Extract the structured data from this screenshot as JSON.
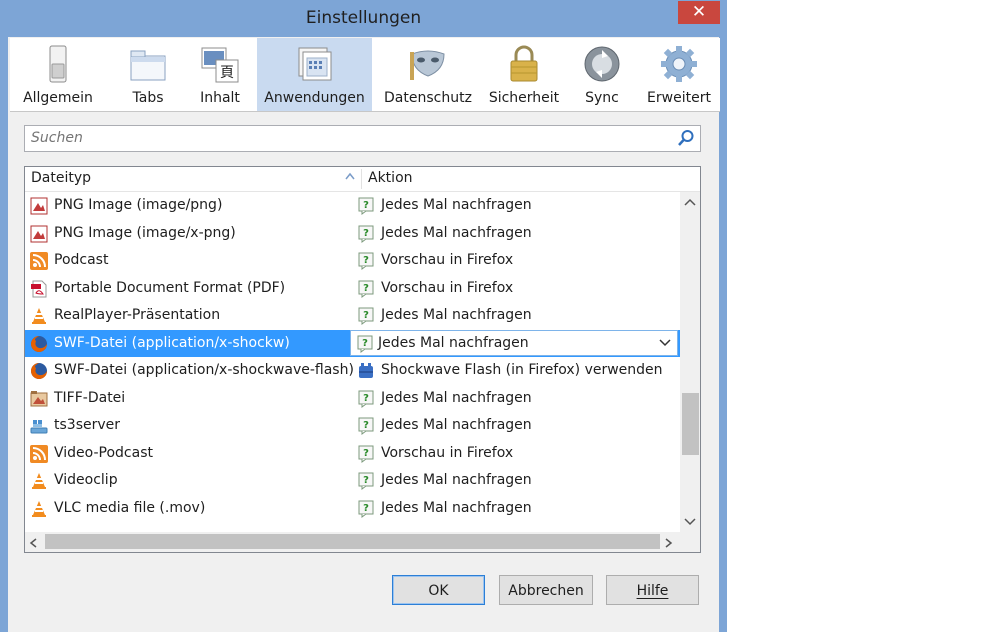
{
  "window": {
    "title": "Einstellungen",
    "close": "✕"
  },
  "toolbar": {
    "items": [
      {
        "label": "Allgemein",
        "icon": "switch-icon"
      },
      {
        "label": "Tabs",
        "icon": "tabs-icon"
      },
      {
        "label": "Inhalt",
        "icon": "content-icon"
      },
      {
        "label": "Anwendungen",
        "icon": "applications-icon",
        "selected": true
      },
      {
        "label": "Datenschutz",
        "icon": "mask-icon"
      },
      {
        "label": "Sicherheit",
        "icon": "lock-icon"
      },
      {
        "label": "Sync",
        "icon": "sync-icon"
      },
      {
        "label": "Erweitert",
        "icon": "gear-icon"
      }
    ]
  },
  "search": {
    "placeholder": "Suchen"
  },
  "table": {
    "columns": {
      "type": "Dateityp",
      "action": "Aktion"
    },
    "rows": [
      {
        "type": "PNG Image (image/png)",
        "type_icon": "image-icon",
        "action": "Jedes Mal nachfragen",
        "action_icon": "ask-icon"
      },
      {
        "type": "PNG Image (image/x-png)",
        "type_icon": "image-icon",
        "action": "Jedes Mal nachfragen",
        "action_icon": "ask-icon"
      },
      {
        "type": "Podcast",
        "type_icon": "rss-icon",
        "action": "Vorschau in Firefox",
        "action_icon": "ask-icon"
      },
      {
        "type": "Portable Document Format (PDF)",
        "type_icon": "pdf-icon",
        "action": "Vorschau in Firefox",
        "action_icon": "ask-icon"
      },
      {
        "type": "RealPlayer-Präsentation",
        "type_icon": "vlc-icon",
        "action": "Jedes Mal nachfragen",
        "action_icon": "ask-icon"
      },
      {
        "type": "SWF-Datei (application/x-shockw)",
        "type_icon": "firefox-icon",
        "action": "Jedes Mal nachfragen",
        "action_icon": "ask-icon",
        "selected": true
      },
      {
        "type": "SWF-Datei (application/x-shockwave-flash)",
        "type_icon": "firefox-icon",
        "action": "Shockwave Flash (in Firefox) verwenden",
        "action_icon": "plugin-icon"
      },
      {
        "type": "TIFF-Datei",
        "type_icon": "tiff-icon",
        "action": "Jedes Mal nachfragen",
        "action_icon": "ask-icon"
      },
      {
        "type": "ts3server",
        "type_icon": "ts3-icon",
        "action": "Jedes Mal nachfragen",
        "action_icon": "ask-icon"
      },
      {
        "type": "Video-Podcast",
        "type_icon": "rss-icon",
        "action": "Vorschau in Firefox",
        "action_icon": "ask-icon"
      },
      {
        "type": "Videoclip",
        "type_icon": "vlc-icon",
        "action": "Jedes Mal nachfragen",
        "action_icon": "ask-icon"
      },
      {
        "type": "VLC media file (.mov)",
        "type_icon": "vlc-icon",
        "action": "Jedes Mal nachfragen",
        "action_icon": "ask-icon"
      }
    ]
  },
  "buttons": {
    "ok": "OK",
    "cancel": "Abbrechen",
    "help": "Hilfe"
  }
}
